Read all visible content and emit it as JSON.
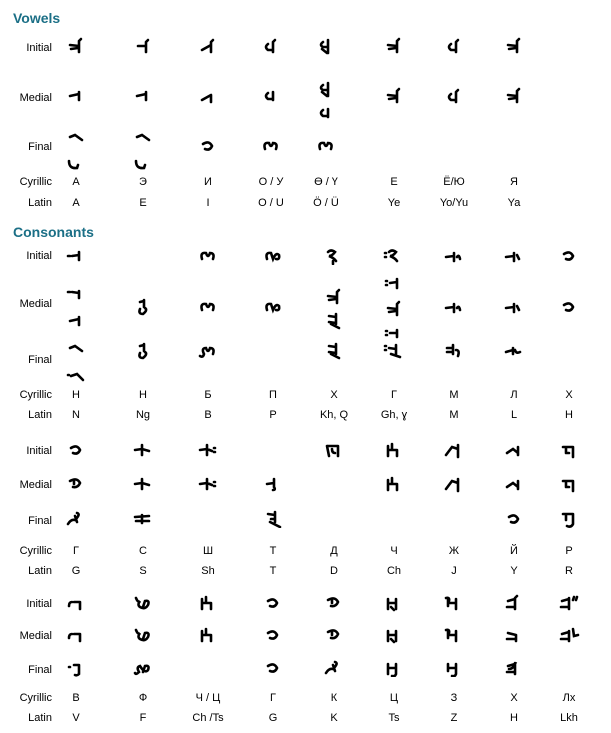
{
  "sections": [
    {
      "title": "Vowels",
      "row_labels": {
        "initial": "Initial",
        "medial": "Medial",
        "final": "Final",
        "cyrillic": "Cyrillic",
        "latin": "Latin"
      },
      "columns": [
        {
          "cyrillic": "А",
          "latin": "A",
          "initial": [
            "ya"
          ],
          "medial": [
            "tooth"
          ],
          "final": [
            "tail",
            "tail-hook"
          ]
        },
        {
          "cyrillic": "Э",
          "latin": "E",
          "initial": [
            "yi"
          ],
          "medial": [
            "tooth"
          ],
          "final": [
            "tail",
            "tail-hook"
          ]
        },
        {
          "cyrillic": "И",
          "latin": "I",
          "initial": [
            "yi2"
          ],
          "medial": [
            "i-medial"
          ],
          "final": [
            "curl"
          ]
        },
        {
          "cyrillic": "О / У",
          "latin": "O / U",
          "initial": [
            "o"
          ],
          "medial": [
            "o-medial"
          ],
          "final": [
            "bow"
          ]
        },
        {
          "cyrillic": "Ө / Ү",
          "latin": "Ö / Ü",
          "initial": [
            "oe"
          ],
          "medial": [
            "oe",
            "o-medial"
          ],
          "final": [
            "bow"
          ]
        },
        {
          "cyrillic": "Е",
          "latin": "Ye",
          "initial": [
            "ya"
          ],
          "medial": [
            "ya"
          ],
          "final": []
        },
        {
          "cyrillic": "Ё/Ю",
          "latin": "Yo/Yu",
          "initial": [
            "o"
          ],
          "medial": [
            "o"
          ],
          "final": []
        },
        {
          "cyrillic": "Я",
          "latin": "Ya",
          "initial": [
            "ya"
          ],
          "medial": [
            "ya"
          ],
          "final": []
        }
      ]
    },
    {
      "title": "Consonants",
      "row_labels": {
        "initial": "Initial",
        "medial": "Medial",
        "final": "Final",
        "cyrillic": "Cyrillic",
        "latin": "Latin"
      },
      "groups": [
        [
          {
            "cyrillic": "Н",
            "latin": "N",
            "initial": [
              "n-init"
            ],
            "medial": [
              "n-dot",
              "tooth"
            ],
            "final": [
              "tail",
              "tail-dot"
            ]
          },
          {
            "cyrillic": "Н",
            "latin": "Ng",
            "initial": [],
            "medial": [
              "ng"
            ],
            "final": [
              "ng"
            ]
          },
          {
            "cyrillic": "Б",
            "latin": "B",
            "initial": [
              "bow"
            ],
            "medial": [
              "bow"
            ],
            "final": [
              "bow-tail"
            ]
          },
          {
            "cyrillic": "П",
            "latin": "P",
            "initial": [
              "p"
            ],
            "medial": [
              "p"
            ],
            "final": []
          },
          {
            "cyrillic": "Х",
            "latin": "Kh, Q",
            "initial": [
              "q"
            ],
            "medial": [
              "ya",
              "q-medial"
            ],
            "final": [
              "q-medial"
            ]
          },
          {
            "cyrillic": "Г",
            "latin": "Gh, ɣ",
            "initial": [
              "q-dot"
            ],
            "medial": [
              "ya-dot",
              "ya",
              "tooth-dot"
            ],
            "final": [
              "q-final-dot"
            ]
          },
          {
            "cyrillic": "М",
            "latin": "M",
            "initial": [
              "m"
            ],
            "medial": [
              "m"
            ],
            "final": [
              "m-final"
            ]
          },
          {
            "cyrillic": "Л",
            "latin": "L",
            "initial": [
              "l"
            ],
            "medial": [
              "l"
            ],
            "final": [
              "l-final"
            ]
          },
          {
            "cyrillic": "Х",
            "latin": "H",
            "initial": [
              "curl"
            ],
            "medial": [
              "curl"
            ],
            "final": []
          }
        ],
        [
          {
            "cyrillic": "Г",
            "latin": "G",
            "initial": [
              "curl"
            ],
            "medial": [
              "g"
            ],
            "final": [
              "g-final"
            ]
          },
          {
            "cyrillic": "С",
            "latin": "S",
            "initial": [
              "s"
            ],
            "medial": [
              "s"
            ],
            "final": [
              "s-final"
            ]
          },
          {
            "cyrillic": "Ш",
            "latin": "Sh",
            "initial": [
              "sh"
            ],
            "medial": [
              "sh"
            ],
            "final": []
          },
          {
            "cyrillic": "Т",
            "latin": "T",
            "initial": [],
            "medial": [
              "t"
            ],
            "final": [
              "t-final"
            ]
          },
          {
            "cyrillic": "Д",
            "latin": "D",
            "initial": [
              "d"
            ],
            "medial": [],
            "final": []
          },
          {
            "cyrillic": "Ч",
            "latin": "Ch",
            "initial": [
              "ch"
            ],
            "medial": [
              "ch"
            ],
            "final": []
          },
          {
            "cyrillic": "Ж",
            "latin": "J",
            "initial": [
              "j"
            ],
            "medial": [
              "j"
            ],
            "final": []
          },
          {
            "cyrillic": "Й",
            "latin": "Y",
            "initial": [
              "y"
            ],
            "medial": [
              "y"
            ],
            "final": [
              "curl"
            ]
          },
          {
            "cyrillic": "Р",
            "latin": "R",
            "initial": [
              "r"
            ],
            "medial": [
              "r"
            ],
            "final": [
              "r-final"
            ]
          }
        ],
        [
          {
            "cyrillic": "В",
            "latin": "V",
            "initial": [
              "v"
            ],
            "medial": [
              "v"
            ],
            "final": [
              "v-final"
            ]
          },
          {
            "cyrillic": "Ф",
            "latin": "F",
            "initial": [
              "f"
            ],
            "medial": [
              "f"
            ],
            "final": [
              "f-final"
            ]
          },
          {
            "cyrillic": "Ч / Ц",
            "latin": "Ch /Ts",
            "initial": [
              "ch"
            ],
            "medial": [
              "ch"
            ],
            "final": []
          },
          {
            "cyrillic": "Г",
            "latin": "G",
            "initial": [
              "curl"
            ],
            "medial": [
              "curl"
            ],
            "final": [
              "curl"
            ]
          },
          {
            "cyrillic": "К",
            "latin": "K",
            "initial": [
              "g"
            ],
            "medial": [
              "g"
            ],
            "final": [
              "g-final"
            ]
          },
          {
            "cyrillic": "Ц",
            "latin": "Ts",
            "initial": [
              "ts"
            ],
            "medial": [
              "ts"
            ],
            "final": [
              "ts-final"
            ]
          },
          {
            "cyrillic": "З",
            "latin": "Z",
            "initial": [
              "z"
            ],
            "medial": [
              "z"
            ],
            "final": [
              "z-final"
            ]
          },
          {
            "cyrillic": "Х",
            "latin": "H",
            "initial": [
              "h"
            ],
            "medial": [
              "h-medial"
            ],
            "final": [
              "h-final"
            ]
          },
          {
            "cyrillic": "Лх",
            "latin": "Lkh",
            "initial": [
              "lh"
            ],
            "medial": [
              "lh-medial"
            ],
            "final": []
          }
        ]
      ]
    }
  ]
}
